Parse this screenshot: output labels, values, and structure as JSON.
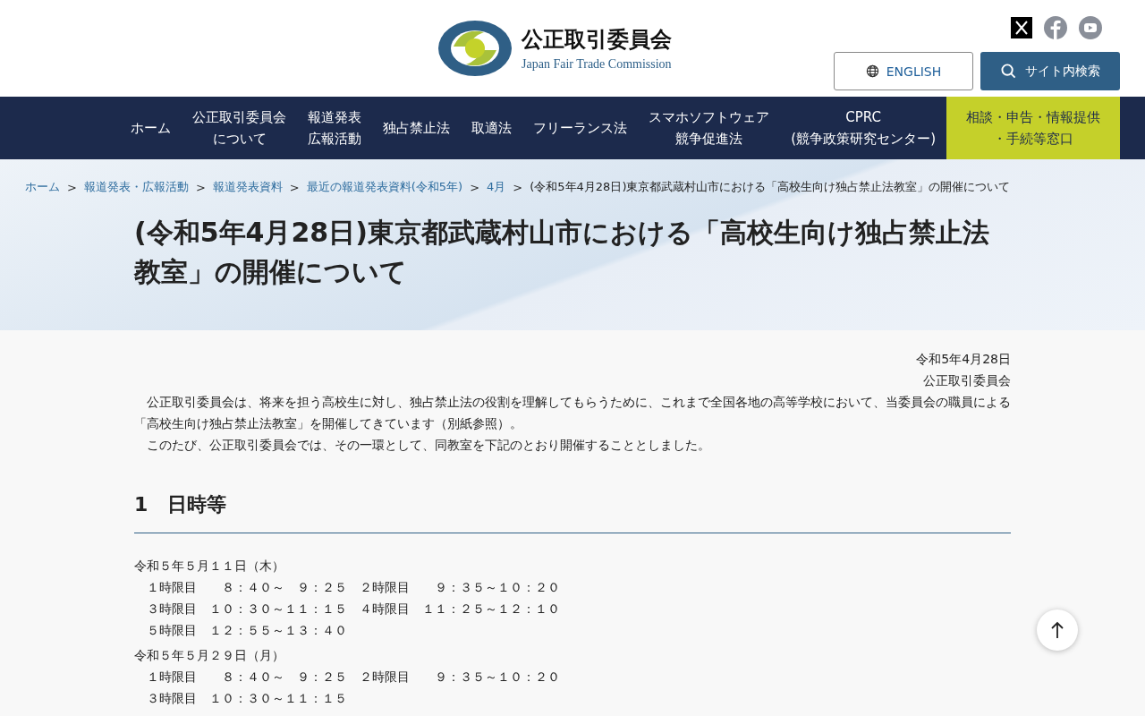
{
  "header": {
    "logo_title": "公正取引委員会",
    "logo_subtitle": "Japan Fair Trade Commission",
    "english_button": "ENGLISH",
    "search_button": "サイト内検索"
  },
  "nav": [
    {
      "lines": [
        "ホーム"
      ],
      "kind": "normal"
    },
    {
      "lines": [
        "公正取引委員会",
        "について"
      ],
      "kind": "normal"
    },
    {
      "lines": [
        "報道発表",
        "広報活動"
      ],
      "kind": "normal"
    },
    {
      "lines": [
        "独占禁止法"
      ],
      "kind": "normal"
    },
    {
      "lines": [
        "取適法"
      ],
      "kind": "normal"
    },
    {
      "lines": [
        "フリーランス法"
      ],
      "kind": "normal"
    },
    {
      "lines": [
        "スマホソフトウェア",
        "競争促進法"
      ],
      "kind": "normal"
    },
    {
      "lines": [
        "CPRC",
        "(競争政策研究センター)"
      ],
      "kind": "normal"
    },
    {
      "lines": [
        "相談・申告・情報提供",
        "・手続等窓口"
      ],
      "kind": "highlight"
    }
  ],
  "breadcrumb": [
    {
      "label": "ホーム",
      "kind": "link"
    },
    {
      "separator": ">",
      "label": "報道発表・広報活動",
      "kind": "link"
    },
    {
      "separator": ">",
      "label": "報道発表資料",
      "kind": "link"
    },
    {
      "separator": ">",
      "label": "最近の報道発表資料(令和5年)",
      "kind": "link"
    },
    {
      "separator": ">",
      "label": "4月",
      "kind": "link"
    },
    {
      "separator": ">",
      "label": "(令和5年4月28日)東京都武蔵村山市における「高校生向け独占禁止法教室」の開催について",
      "kind": "current"
    }
  ],
  "page_title": "(令和5年4月28日)東京都武蔵村山市における「高校生向け独占禁止法教室」の開催について",
  "date": "令和5年4月28日",
  "issuer": "公正取引委員会",
  "paragraphs": [
    "　公正取引委員会は、将来を担う高校生に対し、独占禁止法の役割を理解してもらうために、これまで全国各地の高等学校において、当委員会の職員による「高校生向け独占禁止法教室」を開催してきています（別紙参照）。",
    "　このたび、公正取引委員会では、その一環として、同教室を下記のとおり開催することとしました。"
  ],
  "section_heading": "1　日時等",
  "schedule": [
    {
      "date": "令和５年５月１１日（木）",
      "periods": [
        "　１時限目　　８：４０～　９：２５　２時限目　　９：３５～１０：２０",
        "　３時限目　１０：３０～１１：１５　４時限目　１１：２５～１２：１０",
        "　５時限目　１２：５５～１３：４０"
      ]
    },
    {
      "date": "令和５年５月２９日（月）",
      "periods": [
        "　１時限目　　８：４０～　９：２５　２時限目　　９：３５～１０：２０",
        "　３時限目　１０：３０～１１：１５"
      ]
    }
  ]
}
